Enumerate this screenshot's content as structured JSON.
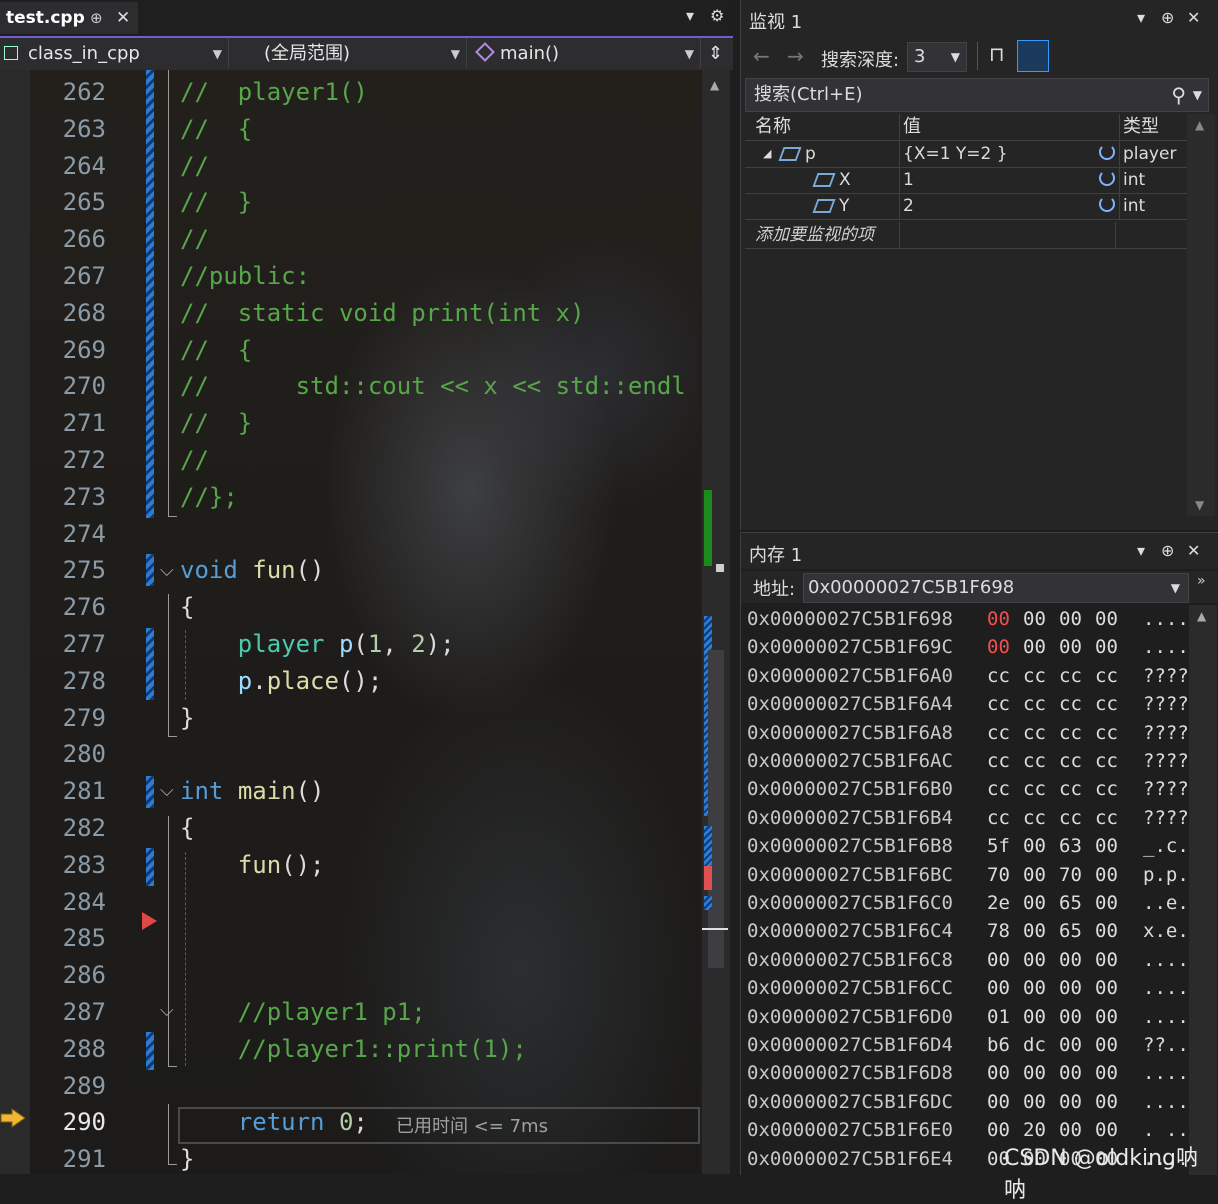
{
  "editor": {
    "tab": {
      "file": "test.cpp",
      "pin": "⊕",
      "close": "✕"
    },
    "tab_controls": {
      "dropdown": "▾",
      "settings": "⚙"
    },
    "nav": {
      "project": "class_in_cpp",
      "scope": "(全局范围)",
      "member": "main()",
      "split": "⇕"
    },
    "lines": [
      {
        "n": "262",
        "html": "<span class='cm'>//  player1()</span>"
      },
      {
        "n": "263",
        "html": "<span class='cm'>//  {</span>"
      },
      {
        "n": "264",
        "html": "<span class='cm'>//</span>"
      },
      {
        "n": "265",
        "html": "<span class='cm'>//  }</span>"
      },
      {
        "n": "266",
        "html": "<span class='cm'>//</span>"
      },
      {
        "n": "267",
        "html": "<span class='cm'>//public:</span>"
      },
      {
        "n": "268",
        "html": "<span class='cm'>//  static void print(int x)</span>"
      },
      {
        "n": "269",
        "html": "<span class='cm'>//  {</span>"
      },
      {
        "n": "270",
        "html": "<span class='cm'>//      std::cout &lt;&lt; x &lt;&lt; std::endl</span>"
      },
      {
        "n": "271",
        "html": "<span class='cm'>//  }</span>"
      },
      {
        "n": "272",
        "html": "<span class='cm'>//</span>"
      },
      {
        "n": "273",
        "html": "<span class='cm'>//};</span>"
      },
      {
        "n": "274",
        "html": ""
      },
      {
        "n": "275",
        "html": "<span class='kw'>void</span> <span class='fn'>fun</span>()"
      },
      {
        "n": "276",
        "html": "{"
      },
      {
        "n": "277",
        "html": "    <span class='ty'>player</span> <span class='var'>p</span>(<span class='num'>1</span>, <span class='num'>2</span>);"
      },
      {
        "n": "278",
        "html": "    <span class='var'>p</span>.<span class='fn'>place</span>();"
      },
      {
        "n": "279",
        "html": "}"
      },
      {
        "n": "280",
        "html": ""
      },
      {
        "n": "281",
        "html": "<span class='kw'>int</span> <span class='fn'>main</span>()"
      },
      {
        "n": "282",
        "html": "{"
      },
      {
        "n": "283",
        "html": "    <span class='fn'>fun</span>();"
      },
      {
        "n": "284",
        "html": ""
      },
      {
        "n": "285",
        "html": ""
      },
      {
        "n": "286",
        "html": ""
      },
      {
        "n": "287",
        "html": "    <span class='cm'>//player1 p1;</span>"
      },
      {
        "n": "288",
        "html": "    <span class='cm'>//player1::print(1);</span>"
      },
      {
        "n": "289",
        "html": ""
      },
      {
        "n": "290",
        "html": "    <span class='kw'>return</span> <span class='num'>0</span>;"
      },
      {
        "n": "291",
        "html": "}"
      }
    ],
    "current_line": "290",
    "perf_tip": "已用时间 <= 7ms"
  },
  "watch": {
    "title": "监视 1",
    "controls": {
      "dropdown": "▾",
      "pin": "⊕",
      "close": "✕"
    },
    "back": "←",
    "forward": "→",
    "depth_label": "搜索深度:",
    "depth_value": "3",
    "search_placeholder": "搜索(Ctrl+E)",
    "search_icon": "⚲",
    "columns": {
      "name": "名称",
      "value": "值",
      "type": "类型"
    },
    "rows": [
      {
        "name": "p",
        "value": "{X=1 Y=2 }",
        "type": "player"
      },
      {
        "name": "X",
        "value": "1",
        "type": "int"
      },
      {
        "name": "Y",
        "value": "2",
        "type": "int"
      }
    ],
    "add_item": "添加要监视的项"
  },
  "memory": {
    "title": "内存 1",
    "controls": {
      "dropdown": "▾",
      "pin": "⊕",
      "close": "✕"
    },
    "address_label": "地址:",
    "address_value": "0x00000027C5B1F698",
    "rows": [
      {
        "addr": "0x00000027C5B1F698",
        "bytes": [
          "00",
          "00",
          "00",
          "00"
        ],
        "ascii": "....",
        "changed": [
          0
        ]
      },
      {
        "addr": "0x00000027C5B1F69C",
        "bytes": [
          "00",
          "00",
          "00",
          "00"
        ],
        "ascii": "....",
        "changed": [
          0
        ]
      },
      {
        "addr": "0x00000027C5B1F6A0",
        "bytes": [
          "cc",
          "cc",
          "cc",
          "cc"
        ],
        "ascii": "????",
        "changed": []
      },
      {
        "addr": "0x00000027C5B1F6A4",
        "bytes": [
          "cc",
          "cc",
          "cc",
          "cc"
        ],
        "ascii": "????",
        "changed": []
      },
      {
        "addr": "0x00000027C5B1F6A8",
        "bytes": [
          "cc",
          "cc",
          "cc",
          "cc"
        ],
        "ascii": "????",
        "changed": []
      },
      {
        "addr": "0x00000027C5B1F6AC",
        "bytes": [
          "cc",
          "cc",
          "cc",
          "cc"
        ],
        "ascii": "????",
        "changed": []
      },
      {
        "addr": "0x00000027C5B1F6B0",
        "bytes": [
          "cc",
          "cc",
          "cc",
          "cc"
        ],
        "ascii": "????",
        "changed": []
      },
      {
        "addr": "0x00000027C5B1F6B4",
        "bytes": [
          "cc",
          "cc",
          "cc",
          "cc"
        ],
        "ascii": "????",
        "changed": []
      },
      {
        "addr": "0x00000027C5B1F6B8",
        "bytes": [
          "5f",
          "00",
          "63",
          "00"
        ],
        "ascii": "_.c.",
        "changed": []
      },
      {
        "addr": "0x00000027C5B1F6BC",
        "bytes": [
          "70",
          "00",
          "70",
          "00"
        ],
        "ascii": "p.p.",
        "changed": []
      },
      {
        "addr": "0x00000027C5B1F6C0",
        "bytes": [
          "2e",
          "00",
          "65",
          "00"
        ],
        "ascii": "..e.",
        "changed": []
      },
      {
        "addr": "0x00000027C5B1F6C4",
        "bytes": [
          "78",
          "00",
          "65",
          "00"
        ],
        "ascii": "x.e.",
        "changed": []
      },
      {
        "addr": "0x00000027C5B1F6C8",
        "bytes": [
          "00",
          "00",
          "00",
          "00"
        ],
        "ascii": "....",
        "changed": []
      },
      {
        "addr": "0x00000027C5B1F6CC",
        "bytes": [
          "00",
          "00",
          "00",
          "00"
        ],
        "ascii": "....",
        "changed": []
      },
      {
        "addr": "0x00000027C5B1F6D0",
        "bytes": [
          "01",
          "00",
          "00",
          "00"
        ],
        "ascii": "....",
        "changed": []
      },
      {
        "addr": "0x00000027C5B1F6D4",
        "bytes": [
          "b6",
          "dc",
          "00",
          "00"
        ],
        "ascii": "??..",
        "changed": []
      },
      {
        "addr": "0x00000027C5B1F6D8",
        "bytes": [
          "00",
          "00",
          "00",
          "00"
        ],
        "ascii": "....",
        "changed": []
      },
      {
        "addr": "0x00000027C5B1F6DC",
        "bytes": [
          "00",
          "00",
          "00",
          "00"
        ],
        "ascii": "....",
        "changed": []
      },
      {
        "addr": "0x00000027C5B1F6E0",
        "bytes": [
          "00",
          "20",
          "00",
          "00"
        ],
        "ascii": ". ..",
        "changed": []
      },
      {
        "addr": "0x00000027C5B1F6E4",
        "bytes": [
          "00",
          "00",
          "00",
          "00"
        ],
        "ascii": "....",
        "changed": []
      }
    ]
  },
  "watermark": "CSDN @oldking呐呐"
}
